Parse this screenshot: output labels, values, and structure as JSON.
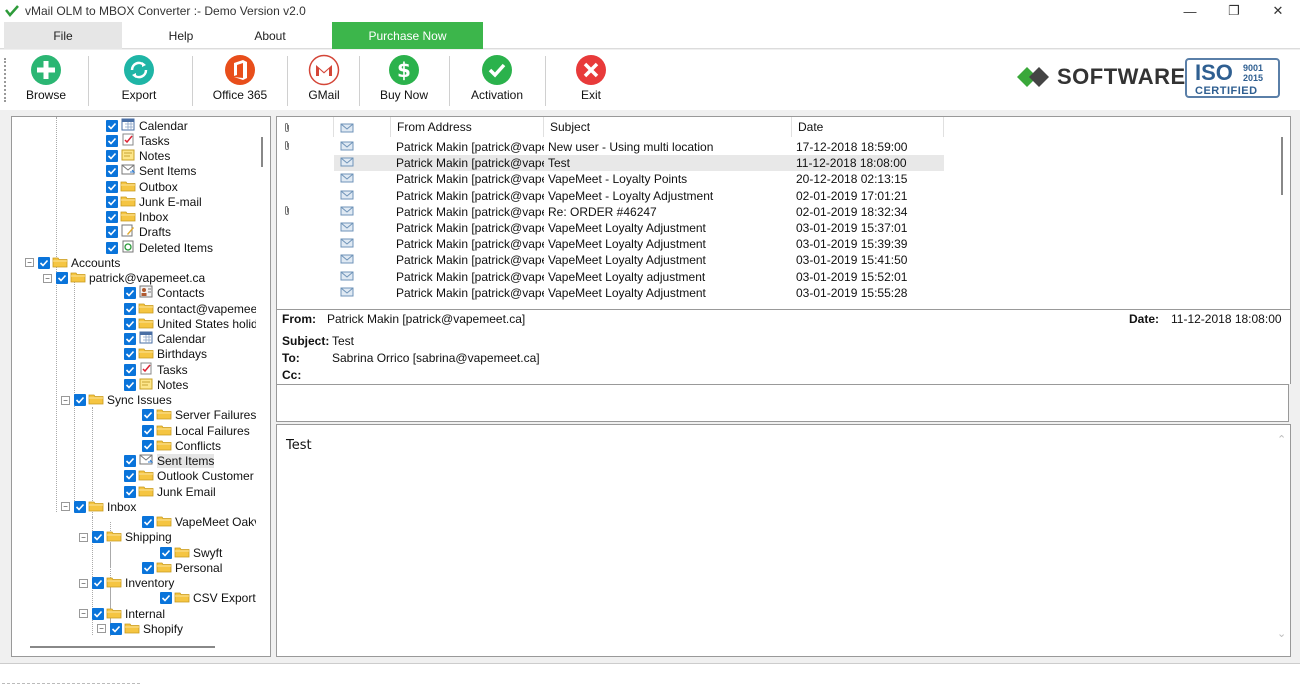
{
  "window": {
    "title": "vMail OLM to MBOX Converter :- Demo Version v2.0",
    "minimize": "—",
    "maximize": "❐",
    "close": "✕"
  },
  "menu": {
    "file": "File",
    "help": "Help",
    "about": "About",
    "purchase": "Purchase Now",
    "purchase_color": "#3cb64b"
  },
  "toolbar": {
    "browse": "Browse",
    "export": "Export",
    "office365": "Office 365",
    "gmail": "GMail",
    "buynow": "Buy Now",
    "activation": "Activation",
    "exit": "Exit"
  },
  "brand": {
    "logo_word": "SOFTWARE",
    "iso_big": "ISO",
    "iso_small_1": "9001",
    "iso_small_2": "2015",
    "iso_cert": "CERTIFIED"
  },
  "tree": [
    {
      "label": "Calendar",
      "depth": 2,
      "icon": "calendar-icon"
    },
    {
      "label": "Tasks",
      "depth": 2,
      "icon": "tasks-icon"
    },
    {
      "label": "Notes",
      "depth": 2,
      "icon": "notes-icon"
    },
    {
      "label": "Sent Items",
      "depth": 2,
      "icon": "sent-items-icon"
    },
    {
      "label": "Outbox",
      "depth": 2,
      "icon": "folder-icon"
    },
    {
      "label": "Junk E-mail",
      "depth": 2,
      "icon": "folder-icon"
    },
    {
      "label": "Inbox",
      "depth": 2,
      "icon": "folder-icon"
    },
    {
      "label": "Drafts",
      "depth": 2,
      "icon": "drafts-icon"
    },
    {
      "label": "Deleted Items",
      "depth": 2,
      "icon": "deleted-items-icon"
    },
    {
      "label": "Accounts",
      "depth": 0,
      "icon": "folder-icon",
      "expander": "−"
    },
    {
      "label": "patrick@vapemeet.ca",
      "depth": 1,
      "icon": "folder-icon",
      "expander": "−"
    },
    {
      "label": "Contacts",
      "depth": 3,
      "icon": "contacts-icon"
    },
    {
      "label": "contact@vapemeet.ca",
      "depth": 3,
      "icon": "folder-icon"
    },
    {
      "label": "United States holidays",
      "depth": 3,
      "icon": "folder-icon"
    },
    {
      "label": "Calendar",
      "depth": 3,
      "icon": "calendar-icon"
    },
    {
      "label": "Birthdays",
      "depth": 3,
      "icon": "folder-icon"
    },
    {
      "label": "Tasks",
      "depth": 3,
      "icon": "tasks-icon"
    },
    {
      "label": "Notes",
      "depth": 3,
      "icon": "notes-icon"
    },
    {
      "label": "Sync Issues",
      "depth": 2,
      "icon": "folder-icon",
      "expander": "−"
    },
    {
      "label": "Server Failures",
      "depth": 4,
      "icon": "folder-icon"
    },
    {
      "label": "Local Failures",
      "depth": 4,
      "icon": "folder-icon"
    },
    {
      "label": "Conflicts",
      "depth": 4,
      "icon": "folder-icon"
    },
    {
      "label": "Sent Items",
      "depth": 3,
      "icon": "sent-items-icon",
      "selected": true
    },
    {
      "label": "Outlook Customer Manager",
      "depth": 3,
      "icon": "folder-icon"
    },
    {
      "label": "Junk Email",
      "depth": 3,
      "icon": "folder-icon"
    },
    {
      "label": "Inbox",
      "depth": 2,
      "icon": "folder-icon",
      "expander": "−"
    },
    {
      "label": "VapeMeet Oakville",
      "depth": 4,
      "icon": "folder-icon"
    },
    {
      "label": "Shipping",
      "depth": 3,
      "icon": "folder-icon",
      "expander": "−"
    },
    {
      "label": "Swyft",
      "depth": 5,
      "icon": "folder-icon"
    },
    {
      "label": "Personal",
      "depth": 4,
      "icon": "folder-icon"
    },
    {
      "label": "Inventory",
      "depth": 3,
      "icon": "folder-icon",
      "expander": "−"
    },
    {
      "label": "CSV Exports (Backups",
      "depth": 5,
      "icon": "folder-icon"
    },
    {
      "label": "Internal",
      "depth": 3,
      "icon": "folder-icon",
      "expander": "−"
    },
    {
      "label": "Shopify",
      "depth": 4,
      "icon": "folder-icon",
      "expander": "−"
    }
  ],
  "list": {
    "headers": {
      "from": "From Address",
      "subject": "Subject",
      "date": "Date"
    },
    "rows": [
      {
        "attach": true,
        "from": "Patrick Makin [patrick@vape...",
        "subject": "New user - Using multi location",
        "date": "17-12-2018 18:59:00"
      },
      {
        "attach": false,
        "from": "Patrick Makin [patrick@vape...",
        "subject": "Test",
        "date": "11-12-2018 18:08:00",
        "selected": true
      },
      {
        "attach": false,
        "from": "Patrick Makin [patrick@vape...",
        "subject": "VapeMeet - Loyalty Points",
        "date": "20-12-2018 02:13:15"
      },
      {
        "attach": false,
        "from": "Patrick Makin [patrick@vape...",
        "subject": "VapeMeet - Loyalty Adjustment",
        "date": "02-01-2019 17:01:21"
      },
      {
        "attach": true,
        "from": "Patrick Makin [patrick@vape...",
        "subject": "Re: ORDER #46247",
        "date": "02-01-2019 18:32:34"
      },
      {
        "attach": false,
        "from": "Patrick Makin [patrick@vape...",
        "subject": "VapeMeet Loyalty Adjustment",
        "date": "03-01-2019 15:37:01"
      },
      {
        "attach": false,
        "from": "Patrick Makin [patrick@vape...",
        "subject": "VapeMeet Loyalty Adjustment",
        "date": "03-01-2019 15:39:39"
      },
      {
        "attach": false,
        "from": "Patrick Makin [patrick@vape...",
        "subject": "VapeMeet Loyalty Adjustment",
        "date": "03-01-2019 15:41:50"
      },
      {
        "attach": false,
        "from": "Patrick Makin [patrick@vape...",
        "subject": "VapeMeet Loyalty adjustment",
        "date": "03-01-2019 15:52:01"
      },
      {
        "attach": false,
        "from": "Patrick Makin [patrick@vape...",
        "subject": "VapeMeet Loyalty Adjustment",
        "date": "03-01-2019 15:55:28"
      }
    ]
  },
  "message": {
    "from_label": "From:",
    "from": "Patrick Makin [patrick@vapemeet.ca]",
    "date_label": "Date:",
    "date": "11-12-2018 18:08:00",
    "subject_label": "Subject:",
    "subject": "Test",
    "to_label": "To:",
    "to": "Sabrina Orrico [sabrina@vapemeet.ca]",
    "cc_label": "Cc:",
    "cc": "",
    "body": "Test"
  }
}
